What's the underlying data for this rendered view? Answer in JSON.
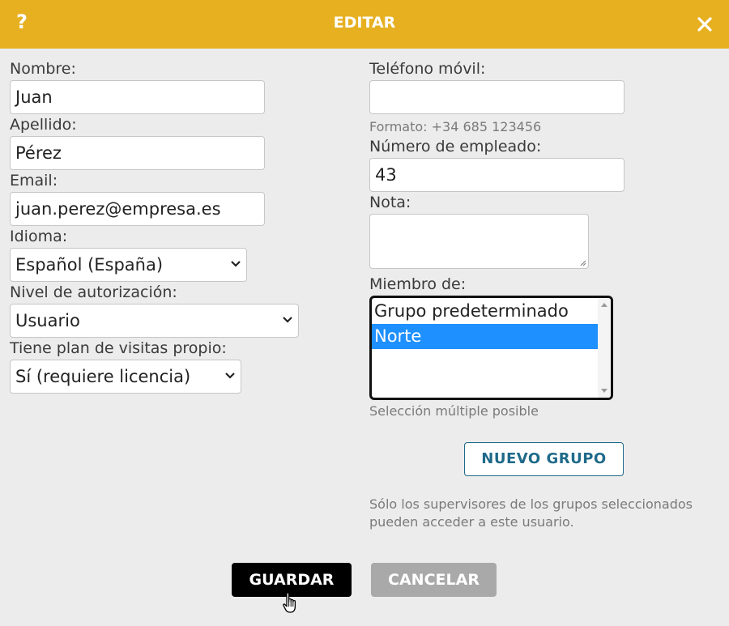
{
  "header": {
    "help_label": "?",
    "title": "EDITAR",
    "close_icon": "close-icon",
    "background": "#e6b021"
  },
  "form": {
    "nombre": {
      "label": "Nombre:",
      "value": "Juan"
    },
    "apellido": {
      "label": "Apellido:",
      "value": "Pérez"
    },
    "email": {
      "label": "Email:",
      "value": "juan.perez@empresa.es"
    },
    "idioma": {
      "label": "Idioma:",
      "value": "Español (España)"
    },
    "nivel": {
      "label": "Nivel de autorización:",
      "value": "Usuario"
    },
    "plan": {
      "label": "Tiene plan de visitas propio:",
      "value": "Sí (requiere licencia)"
    },
    "telefono": {
      "label": "Teléfono móvil:",
      "value": "",
      "hint": "Formato: +34 685 123456"
    },
    "empleado": {
      "label": "Número de empleado:",
      "value": "43"
    },
    "nota": {
      "label": "Nota:",
      "value": ""
    },
    "miembro": {
      "label": "Miembro de:",
      "options": [
        {
          "label": "Grupo predeterminado",
          "selected": false
        },
        {
          "label": "Norte",
          "selected": true
        }
      ],
      "hint": "Selección múltiple posible"
    }
  },
  "buttons": {
    "new_group": "NUEVO GRUPO",
    "save": "GUARDAR",
    "cancel": "CANCELAR"
  },
  "note": "Sólo los supervisores de los grupos seleccionados pueden acceder a este usuario.",
  "colors": {
    "accent": "#e6b021",
    "link": "#1f6a8a",
    "selection": "#1e90ff"
  }
}
